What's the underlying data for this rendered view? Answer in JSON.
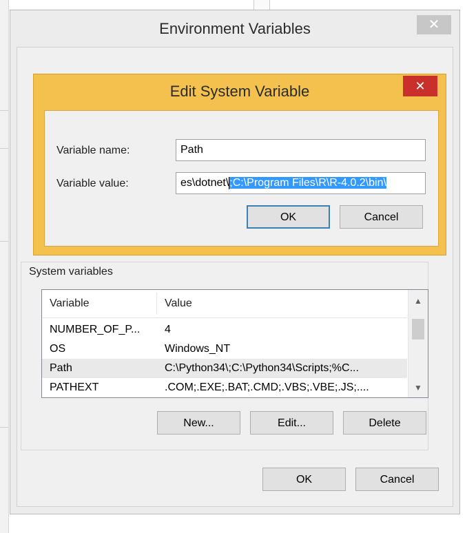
{
  "env_dialog": {
    "title": "Environment Variables",
    "close_glyph": "✕",
    "system_variables_label": "System variables",
    "columns": [
      "Variable",
      "Value"
    ],
    "rows": [
      {
        "variable": "NUMBER_OF_P...",
        "value": "4"
      },
      {
        "variable": "OS",
        "value": "Windows_NT"
      },
      {
        "variable": "Path",
        "value": "C:\\Python34\\;C:\\Python34\\Scripts;%C..."
      },
      {
        "variable": "PATHEXT",
        "value": ".COM;.EXE;.BAT;.CMD;.VBS;.VBE;.JS;...."
      }
    ],
    "selected_row": 2,
    "new_label": "New...",
    "edit_label": "Edit...",
    "delete_label": "Delete",
    "ok_label": "OK",
    "cancel_label": "Cancel"
  },
  "edit_dialog": {
    "title": "Edit System Variable",
    "close_glyph": "✕",
    "name_label": "Variable name:",
    "name_value": "Path",
    "value_label": "Variable value:",
    "value_visible_prefix": "es\\dotnet\\",
    "value_selected_text": ";C:\\Program Files\\R\\R-4.0.2\\bin\\",
    "ok_label": "OK",
    "cancel_label": "Cancel"
  },
  "colors": {
    "dialog_frame": "#f4c04e",
    "close_red": "#c9302c",
    "selection": "#3399ff",
    "default_button_border": "#3c7fb1"
  }
}
